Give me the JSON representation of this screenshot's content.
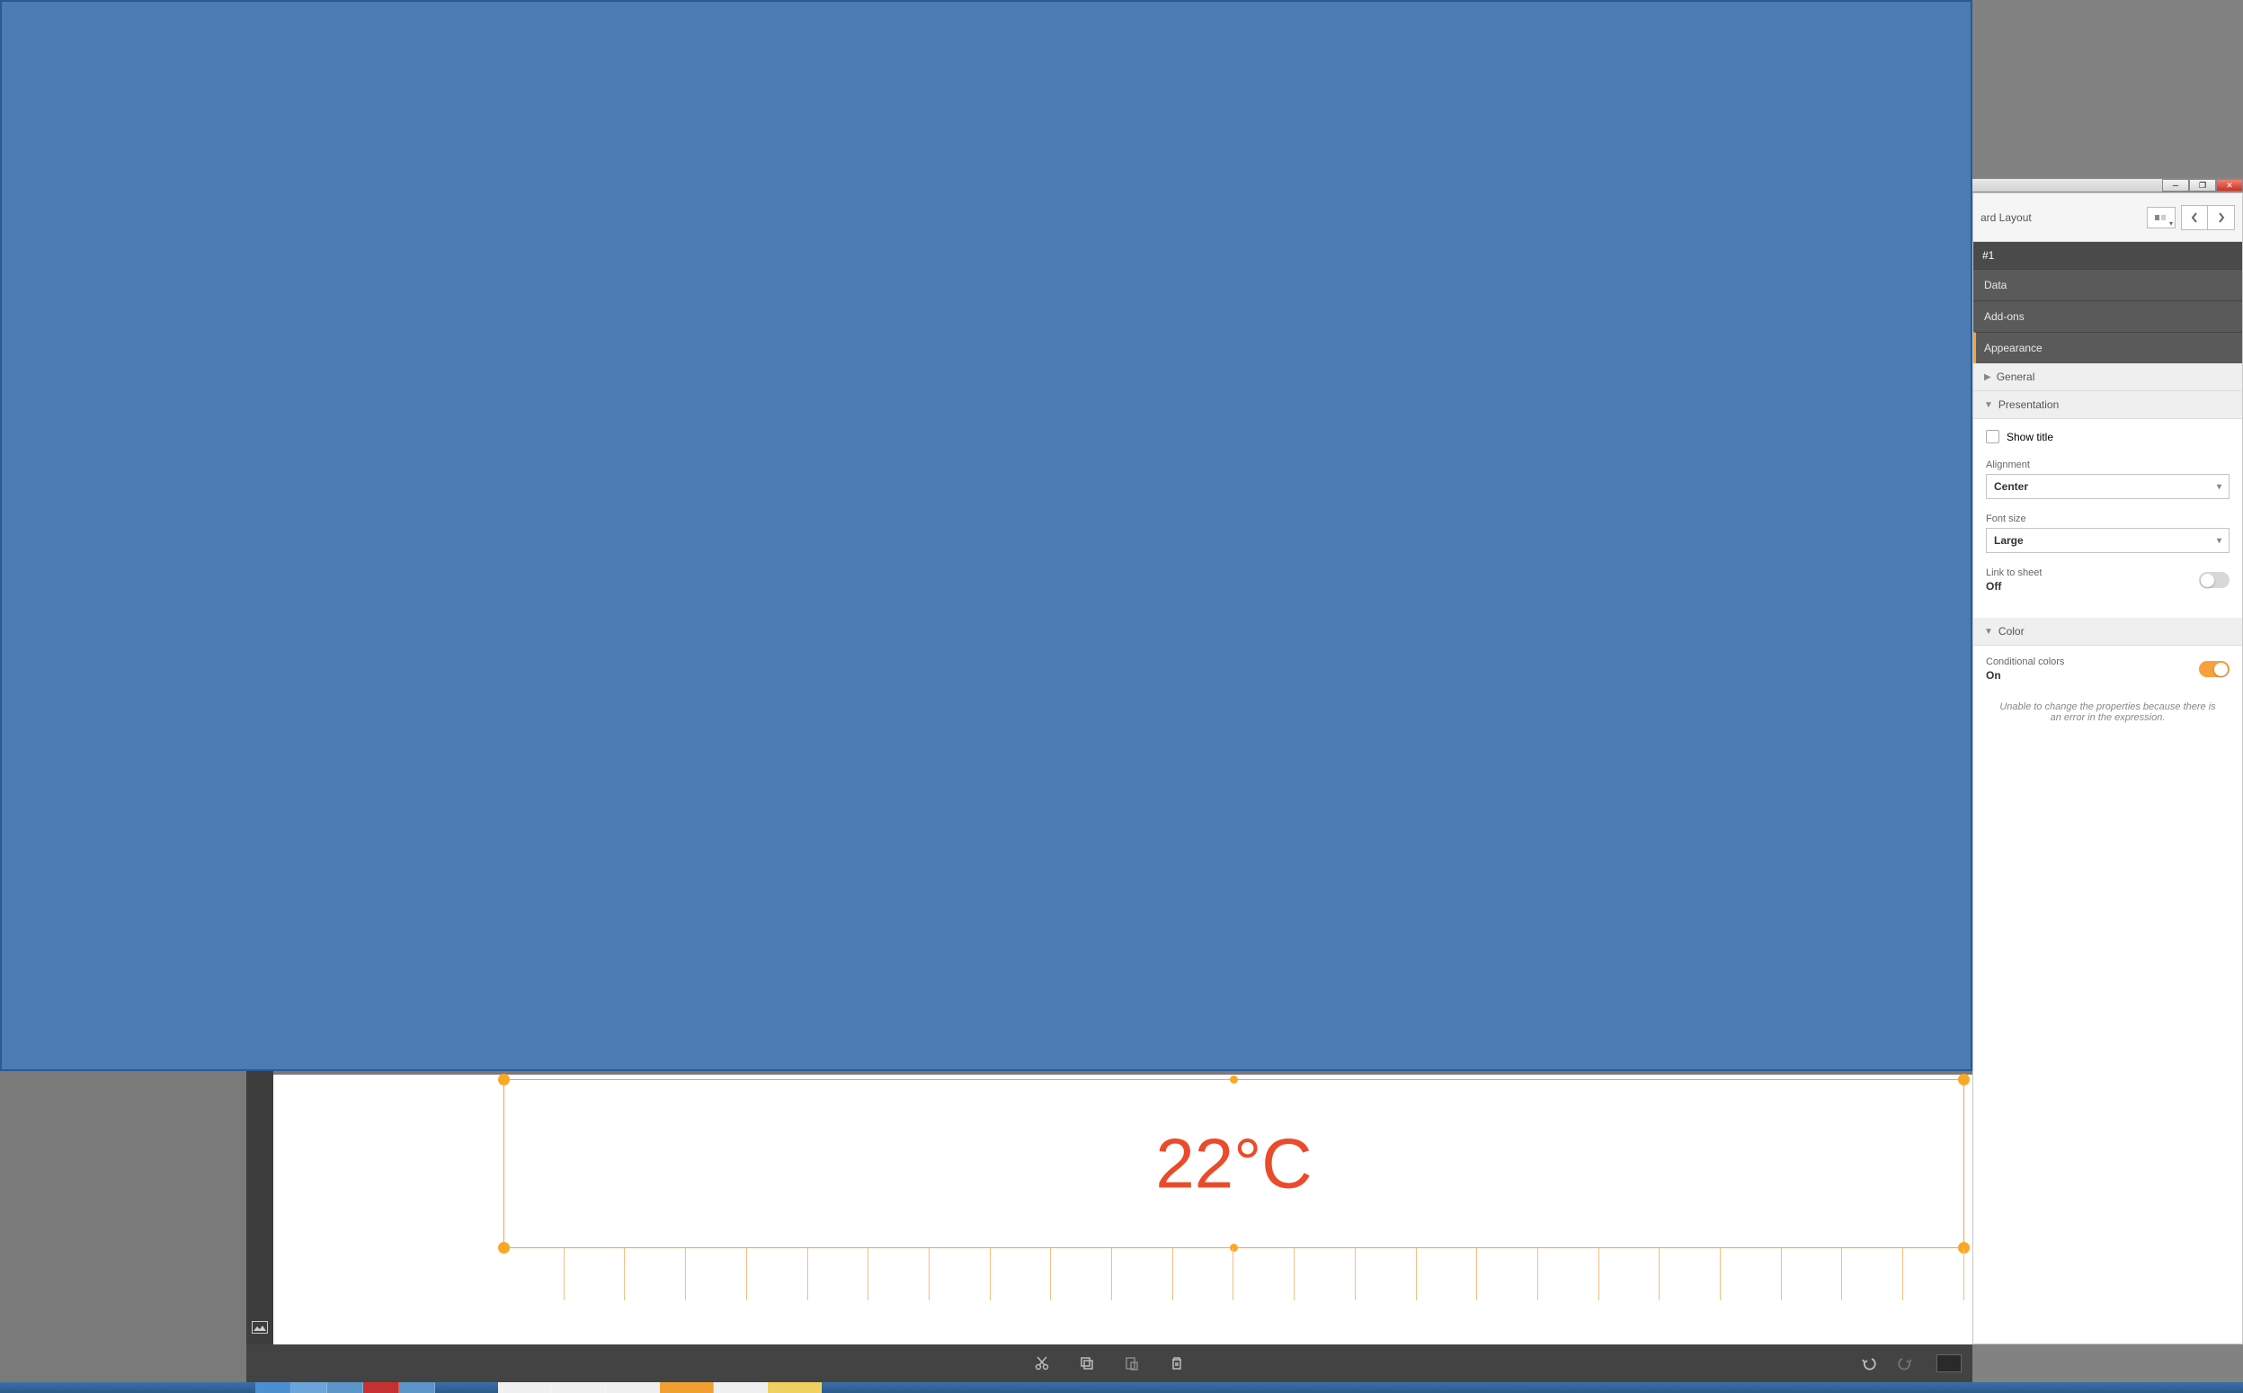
{
  "panel": {
    "header_title": "ard Layout",
    "object_id": "#1",
    "sections": {
      "data": "Data",
      "addons": "Add-ons",
      "appearance": "Appearance"
    },
    "subsections": {
      "general": "General",
      "presentation": "Presentation",
      "color": "Color"
    },
    "presentation": {
      "show_title_label": "Show title",
      "alignment_label": "Alignment",
      "alignment_value": "Center",
      "fontsize_label": "Font size",
      "fontsize_value": "Large",
      "link_label": "Link to sheet",
      "link_value": "Off"
    },
    "color": {
      "cond_label": "Conditional colors",
      "cond_value": "On",
      "error_msg": "Unable to change the properties because there is an error in the expression."
    }
  },
  "canvas": {
    "kpi_value": "22°C"
  },
  "icons": {
    "cut": "✂",
    "copy": "⧉",
    "paste": "📋",
    "delete": "🗑",
    "undo": "↶",
    "redo": "↷",
    "image": "🖼",
    "dropdown": "▾",
    "prev": "‹",
    "next": "›"
  }
}
